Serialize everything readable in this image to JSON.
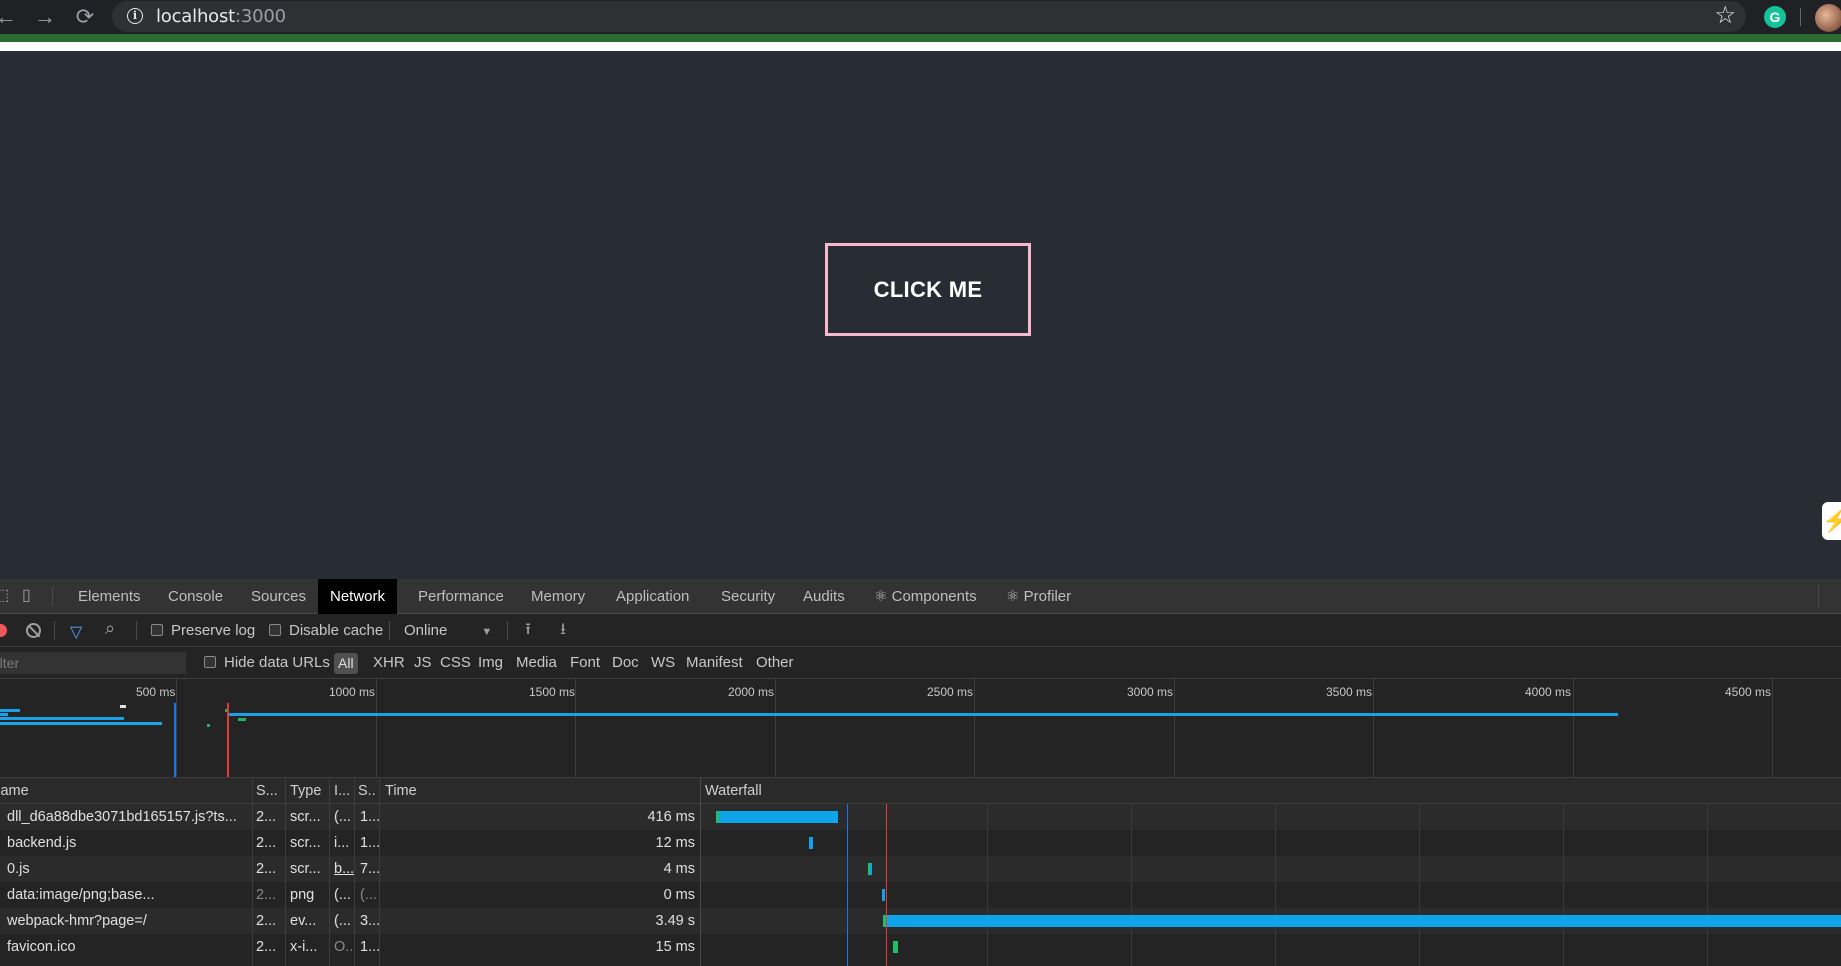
{
  "browser": {
    "url_host": "localhost",
    "url_port": ":3000",
    "grammarly_letter": "G",
    "icons": [
      "back-arrow-icon",
      "forward-arrow-icon",
      "reload-icon",
      "info-icon",
      "star-icon",
      "grammarly-icon",
      "avatar"
    ]
  },
  "page": {
    "button_label": "CLICK ME",
    "side_tab_glyph": "⚡"
  },
  "devtools": {
    "tabs": [
      "Elements",
      "Console",
      "Sources",
      "Network",
      "Performance",
      "Memory",
      "Application",
      "Security",
      "Audits",
      "⚛ Components",
      "⚛ Profiler"
    ],
    "active_tab": "Network",
    "toolbar": {
      "preserve_log": "Preserve log",
      "disable_cache": "Disable cache",
      "throttling": "Online"
    },
    "filters": {
      "placeholder": "Filter",
      "hide_data_urls": "Hide data URLs",
      "types": [
        "All",
        "XHR",
        "JS",
        "CSS",
        "Img",
        "Media",
        "Font",
        "Doc",
        "WS",
        "Manifest",
        "Other"
      ],
      "active_type": "All"
    },
    "overview": {
      "ticks": [
        "500 ms",
        "1000 ms",
        "1500 ms",
        "2000 ms",
        "2500 ms",
        "3000 ms",
        "3500 ms",
        "4000 ms",
        "4500 ms"
      ]
    },
    "table": {
      "headers": {
        "name": "Name",
        "status": "S...",
        "type": "Type",
        "initiator": "I...",
        "size": "S..",
        "time": "Time",
        "waterfall": "Waterfall"
      },
      "rows": [
        {
          "name": "dll_d6a88dbe3071bd165157.js?ts...",
          "status": "2...",
          "type": "scr...",
          "initiator": "(...",
          "size": "1...",
          "time": "416 ms"
        },
        {
          "name": "backend.js",
          "status": "2...",
          "type": "scr...",
          "initiator": "i...",
          "size": "1...",
          "time": "12 ms"
        },
        {
          "name": "0.js",
          "status": "2...",
          "type": "scr...",
          "initiator": "b...",
          "size": "7...",
          "time": "4 ms"
        },
        {
          "name": "data:image/png;base...",
          "status": "2...",
          "type": "png",
          "initiator": "(...",
          "size": "(...",
          "time": "0 ms"
        },
        {
          "name": "webpack-hmr?page=/",
          "status": "2...",
          "type": "ev...",
          "initiator": "(...",
          "size": "3...",
          "time": "3.49 s"
        },
        {
          "name": "favicon.ico",
          "status": "2...",
          "type": "x-i...",
          "initiator": "O...",
          "size": "1...",
          "time": "15 ms"
        }
      ]
    },
    "colors": {
      "bar_blue": "#0fa3ea",
      "bar_green": "#1fbf6a",
      "dom_content_loaded": "#1a73e8",
      "load_event": "#e53935",
      "button_border": "#f7b8cd"
    }
  }
}
